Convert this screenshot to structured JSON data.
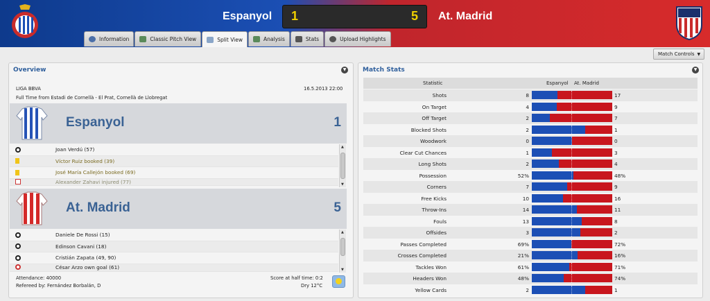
{
  "header": {
    "home_team": "Espanyol",
    "away_team": "At. Madrid",
    "home_score": "1",
    "away_score": "5",
    "home_color": "#1b4fb4",
    "away_color": "#d72b2b"
  },
  "tabs": [
    {
      "label": "Information",
      "icon": "info-icon"
    },
    {
      "label": "Classic Pitch View",
      "icon": "pitch-icon"
    },
    {
      "label": "Split View",
      "icon": "split-view-icon",
      "active": true
    },
    {
      "label": "Analysis",
      "icon": "analysis-icon"
    },
    {
      "label": "Stats",
      "icon": "stats-icon"
    },
    {
      "label": "Upload Highlights",
      "icon": "upload-icon"
    }
  ],
  "match_controls_label": "Match Controls",
  "overview": {
    "title": "Overview",
    "competition": "LIGA BBVA",
    "datetime": "16.5.2013 22:00",
    "venue_line": "Full Time from Estadi de Cornellà - El Prat, Cornellà de Llobregat",
    "home": {
      "name": "Espanyol",
      "score": "1",
      "events": [
        {
          "icon": "goal-icon",
          "text": "Joan Verdú (57)"
        },
        {
          "icon": "yellow-card-icon",
          "text": "Víctor Ruiz booked (39)"
        },
        {
          "icon": "yellow-card-icon",
          "text": "José María Callejón booked (69)"
        },
        {
          "icon": "injury-icon",
          "text": "Alexander Zahavi injured (77)"
        }
      ]
    },
    "away": {
      "name": "At. Madrid",
      "score": "5",
      "events": [
        {
          "icon": "goal-icon",
          "text": "Daniele De Rossi (15)"
        },
        {
          "icon": "goal-icon",
          "text": "Edinson Cavani (18)"
        },
        {
          "icon": "goal-icon",
          "text": "Cristián Zapata (49, 90)"
        },
        {
          "icon": "own-goal-icon",
          "text": "César Arzo own goal (61)"
        }
      ]
    },
    "attendance": "Attendance: 40000",
    "referee": "Refereed by: Fernández Borbalán, D",
    "halftime": "Score at half time: 0:2",
    "weather": "Dry 12°C"
  },
  "stats": {
    "title": "Match Stats",
    "col_statistic": "Statistic",
    "col_home": "Espanyol",
    "col_away": "At. Madrid",
    "rows": [
      {
        "label": "Shots",
        "home": "8",
        "away": "17",
        "hv": 8,
        "av": 17
      },
      {
        "label": "On Target",
        "home": "4",
        "away": "9",
        "hv": 4,
        "av": 9
      },
      {
        "label": "Off Target",
        "home": "2",
        "away": "7",
        "hv": 2,
        "av": 7
      },
      {
        "label": "Blocked Shots",
        "home": "2",
        "away": "1",
        "hv": 2,
        "av": 1
      },
      {
        "label": "Woodwork",
        "home": "0",
        "away": "0",
        "hv": 0,
        "av": 0
      },
      {
        "label": "Clear Cut Chances",
        "home": "1",
        "away": "3",
        "hv": 1,
        "av": 3
      },
      {
        "label": "Long Shots",
        "home": "2",
        "away": "4",
        "hv": 2,
        "av": 4
      },
      {
        "label": "Possession",
        "home": "52%",
        "away": "48%",
        "hv": 52,
        "av": 48
      },
      {
        "label": "Corners",
        "home": "7",
        "away": "9",
        "hv": 7,
        "av": 9
      },
      {
        "label": "Free Kicks",
        "home": "10",
        "away": "16",
        "hv": 10,
        "av": 16
      },
      {
        "label": "Throw-Ins",
        "home": "14",
        "away": "11",
        "hv": 14,
        "av": 11
      },
      {
        "label": "Fouls",
        "home": "13",
        "away": "8",
        "hv": 13,
        "av": 8
      },
      {
        "label": "Offsides",
        "home": "3",
        "away": "2",
        "hv": 3,
        "av": 2
      },
      {
        "label": "Passes Completed",
        "home": "69%",
        "away": "72%",
        "hv": 69,
        "av": 72
      },
      {
        "label": "Crosses Completed",
        "home": "21%",
        "away": "16%",
        "hv": 21,
        "av": 16
      },
      {
        "label": "Tackles Won",
        "home": "61%",
        "away": "71%",
        "hv": 61,
        "av": 71
      },
      {
        "label": "Headers Won",
        "home": "48%",
        "away": "74%",
        "hv": 48,
        "av": 74
      },
      {
        "label": "Yellow Cards",
        "home": "2",
        "away": "1",
        "hv": 2,
        "av": 1
      }
    ]
  }
}
